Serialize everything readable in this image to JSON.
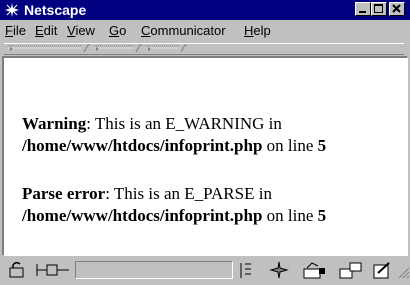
{
  "window": {
    "title": "Netscape"
  },
  "menu": {
    "items": [
      {
        "label_u": "F",
        "label_rest": "ile"
      },
      {
        "label_u": "E",
        "label_rest": "dit"
      },
      {
        "label_u": "V",
        "label_rest": "iew"
      },
      {
        "label_u": "G",
        "label_rest": "o"
      },
      {
        "label_u": "C",
        "label_rest": "ommunicator"
      },
      {
        "label_u": "H",
        "label_rest": "elp"
      }
    ]
  },
  "content": {
    "messages": [
      {
        "type": "Warning",
        "text": ": This is an E_WARNING in",
        "path": "/home/www/htdocs/infoprint.php",
        "on_line": " on line ",
        "line": "5"
      },
      {
        "type": "Parse error",
        "text": ": This is an E_PARSE in",
        "path": "/home/www/htdocs/infoprint.php",
        "on_line": " on line ",
        "line": "5"
      }
    ]
  },
  "icons": {
    "app": "netscape-logo-icon",
    "statusbar": [
      "security-lock-icon",
      "connection-status-icon",
      "component-bar-divider",
      "navigator-icon",
      "mail-icon",
      "discussion-icon",
      "composer-icon",
      "resize-grip-icon"
    ]
  },
  "colors": {
    "titlebar": "#000080",
    "chrome": "#c0c0c0",
    "content_bg": "#ffffff"
  }
}
